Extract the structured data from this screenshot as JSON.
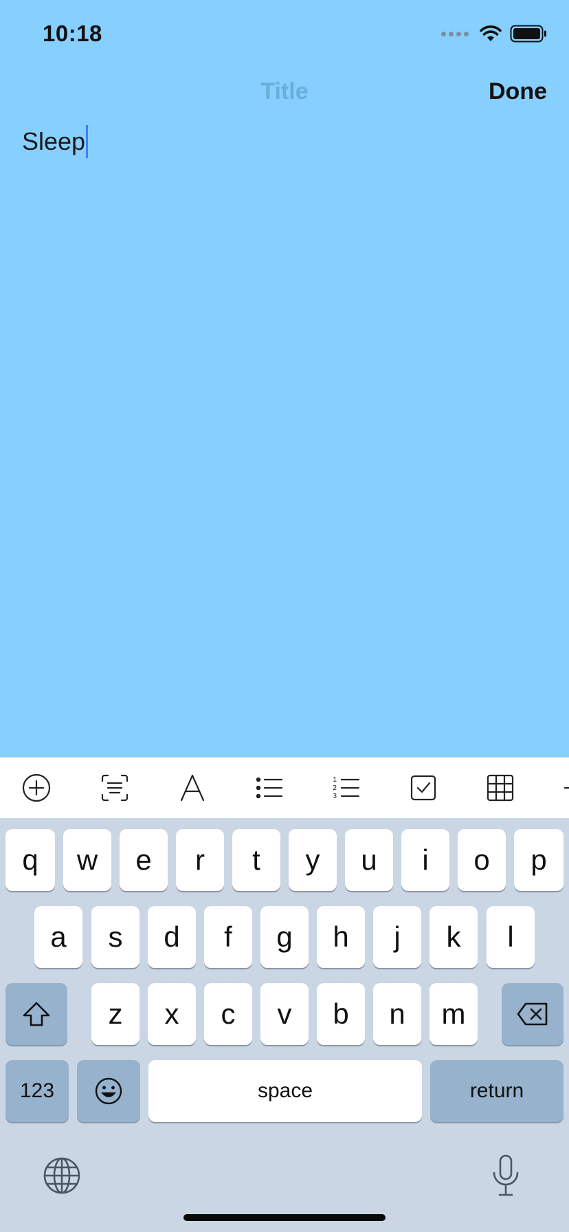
{
  "status": {
    "time": "10:18"
  },
  "nav": {
    "title": "Title",
    "done_label": "Done"
  },
  "note": {
    "text": "Sleep"
  },
  "toolbar": {
    "icons": [
      "add-circle-icon",
      "scan-text-icon",
      "text-format-icon",
      "bulleted-list-icon",
      "numbered-list-icon",
      "checklist-icon",
      "table-icon"
    ]
  },
  "keyboard": {
    "row1": [
      "q",
      "w",
      "e",
      "r",
      "t",
      "y",
      "u",
      "i",
      "o",
      "p"
    ],
    "row2": [
      "a",
      "s",
      "d",
      "f",
      "g",
      "h",
      "j",
      "k",
      "l"
    ],
    "row3": [
      "z",
      "x",
      "c",
      "v",
      "b",
      "n",
      "m"
    ],
    "numbers_label": "123",
    "space_label": "space",
    "return_label": "return"
  },
  "colors": {
    "background": "#87CFFE",
    "keyboard_bg": "#cad6e4",
    "caret": "#3b82f6"
  }
}
